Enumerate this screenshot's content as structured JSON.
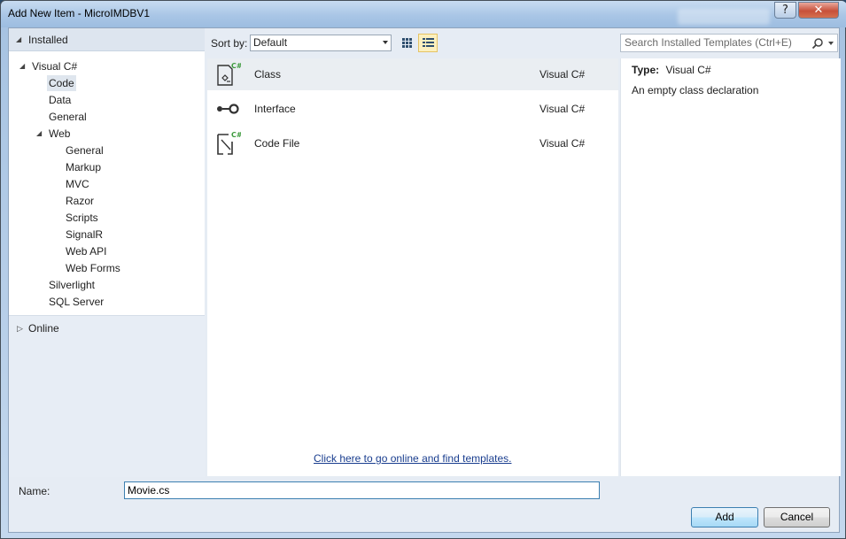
{
  "window": {
    "title": "Add New Item - MicroIMDBV1",
    "help_label": "?",
    "close_label": "✕"
  },
  "tree": {
    "installed_label": "Installed",
    "online_label": "Online",
    "items": [
      {
        "label": "Visual C#",
        "level": 0,
        "expanded": true
      },
      {
        "label": "Code",
        "level": 1,
        "selected": true
      },
      {
        "label": "Data",
        "level": 1
      },
      {
        "label": "General",
        "level": 1
      },
      {
        "label": "Web",
        "level": 1,
        "expanded": true
      },
      {
        "label": "General",
        "level": 2
      },
      {
        "label": "Markup",
        "level": 2
      },
      {
        "label": "MVC",
        "level": 2
      },
      {
        "label": "Razor",
        "level": 2
      },
      {
        "label": "Scripts",
        "level": 2
      },
      {
        "label": "SignalR",
        "level": 2
      },
      {
        "label": "Web API",
        "level": 2
      },
      {
        "label": "Web Forms",
        "level": 2
      },
      {
        "label": "Silverlight",
        "level": 1
      },
      {
        "label": "SQL Server",
        "level": 1
      }
    ]
  },
  "toolbar": {
    "sort_label": "Sort by:",
    "sort_value": "Default"
  },
  "search": {
    "placeholder": "Search Installed Templates (Ctrl+E)"
  },
  "templates": [
    {
      "name": "Class",
      "language": "Visual C#",
      "icon": "class-icon",
      "selected": true
    },
    {
      "name": "Interface",
      "language": "Visual C#",
      "icon": "interface-icon"
    },
    {
      "name": "Code File",
      "language": "Visual C#",
      "icon": "code-file-icon"
    }
  ],
  "online_link": "Click here to go online and find templates.",
  "details": {
    "type_label": "Type:",
    "type_value": "Visual C#",
    "description": "An empty class declaration"
  },
  "name_field": {
    "label": "Name:",
    "value": "Movie.cs"
  },
  "buttons": {
    "add": "Add",
    "cancel": "Cancel"
  },
  "colors": {
    "accent": "#3c7fb1",
    "link": "#1a3e8f",
    "active_view": "#fcf0be",
    "csharp_badge": "#3c9a3c"
  }
}
